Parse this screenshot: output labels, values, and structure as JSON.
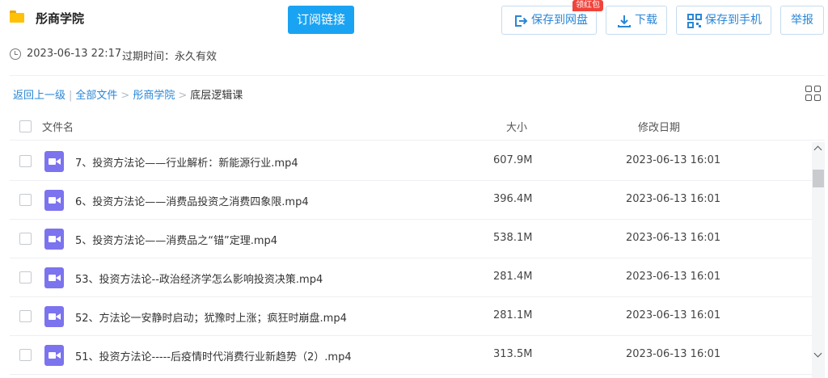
{
  "header": {
    "title": "彤商学院",
    "subscribe_label": "订阅链接",
    "save_to_pan_label": "保存到网盘",
    "redpack_badge": "领红包",
    "download_label": "下载",
    "save_to_phone_label": "保存到手机",
    "report_label": "举报",
    "accent_color": "#1aa3f2"
  },
  "meta": {
    "share_time": "2023-06-13 22:17",
    "expire_text": "过期时间：永久有效"
  },
  "breadcrumb": {
    "back": "返回上一级",
    "all_files": "全部文件",
    "folder": "彤商学院",
    "current": "底层逻辑课",
    "separator_pipe": "|",
    "separator_arrow": ">"
  },
  "table": {
    "columns": {
      "name": "文件名",
      "size": "大小",
      "date": "修改日期"
    },
    "rows": [
      {
        "name": "7、投资方法论——行业解析：新能源行业.mp4",
        "size": "607.9M",
        "date": "2023-06-13 16:01",
        "icon": "video-file-icon"
      },
      {
        "name": "6、投资方法论——消费品投资之消费四象限.mp4",
        "size": "396.4M",
        "date": "2023-06-13 16:01",
        "icon": "video-file-icon"
      },
      {
        "name": "5、投资方法论——消费品之“锚”定理.mp4",
        "size": "538.1M",
        "date": "2023-06-13 16:01",
        "icon": "video-file-icon"
      },
      {
        "name": "53、投资方法论--政治经济学怎么影响投资决策.mp4",
        "size": "281.4M",
        "date": "2023-06-13 16:01",
        "icon": "video-file-icon"
      },
      {
        "name": "52、方法论一安静时启动；犹豫时上涨；疯狂时崩盘.mp4",
        "size": "281.1M",
        "date": "2023-06-13 16:01",
        "icon": "video-file-icon"
      },
      {
        "name": "51、投资方法论-----后疫情时代消费行业新趋势（2）.mp4",
        "size": "313.5M",
        "date": "2023-06-13 16:01",
        "icon": "video-file-icon"
      }
    ]
  }
}
